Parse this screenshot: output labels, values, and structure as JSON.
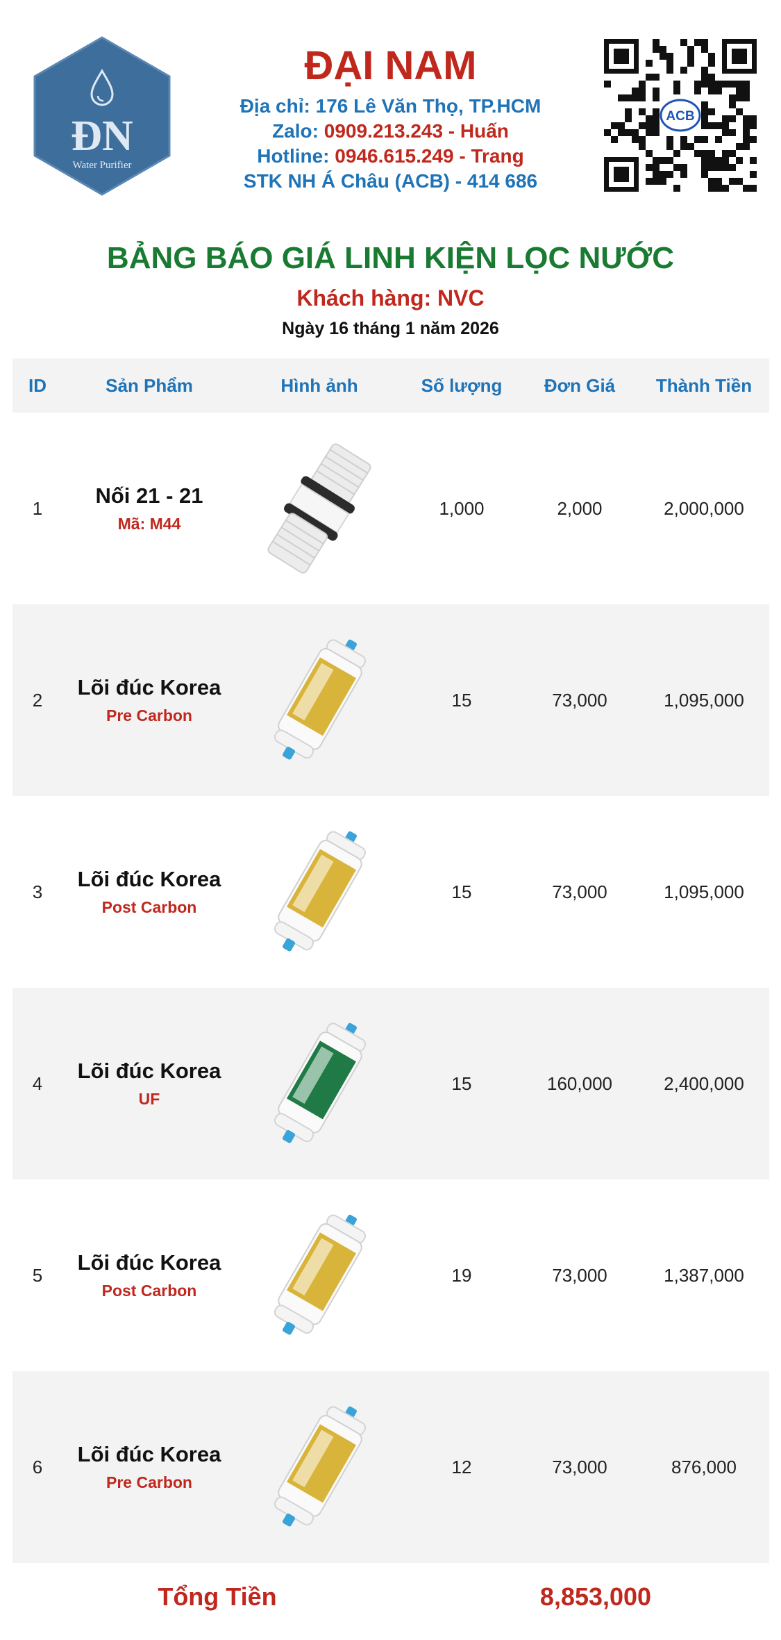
{
  "company": {
    "logo_text": "ĐN",
    "logo_sub": "Water Purifier",
    "name": "ĐẠI NAM",
    "address_label": "Địa chỉ:",
    "address_value": "176 Lê Văn Thọ, TP.HCM",
    "zalo_label": "Zalo:",
    "zalo_value": "0909.213.243 - Huấn",
    "hotline_label": "Hotline:",
    "hotline_value": "0946.615.249 - Trang",
    "bank": "STK NH Á Châu (ACB) - 414 686",
    "qr_badge": "ACB"
  },
  "document": {
    "title": "BẢNG BÁO GIÁ LINH KIỆN LỌC NƯỚC",
    "customer": "Khách hàng: NVC",
    "date": "Ngày 16 tháng 1 năm 2026"
  },
  "table": {
    "headers": {
      "id": "ID",
      "product": "Sản Phẩm",
      "image": "Hình ảnh",
      "quantity": "Số lượng",
      "unit_price": "Đơn Giá",
      "total": "Thành Tiền"
    },
    "rows": [
      {
        "id": "1",
        "name": "Nối 21 - 21",
        "code": "Mã: M44",
        "image": "connector-fitting",
        "quantity": "1,000",
        "unit_price": "2,000",
        "total": "2,000,000"
      },
      {
        "id": "2",
        "name": "Lõi đúc Korea",
        "code": "Pre Carbon",
        "image": "pre-carbon-filter",
        "label_color": "#d9b43a",
        "quantity": "15",
        "unit_price": "73,000",
        "total": "1,095,000"
      },
      {
        "id": "3",
        "name": "Lõi đúc Korea",
        "code": "Post Carbon",
        "image": "post-carbon-filter",
        "label_color": "#d9b43a",
        "quantity": "15",
        "unit_price": "73,000",
        "total": "1,095,000"
      },
      {
        "id": "4",
        "name": "Lõi đúc Korea",
        "code": "UF",
        "image": "uf-filter",
        "label_color": "#1f7a45",
        "quantity": "15",
        "unit_price": "160,000",
        "total": "2,400,000"
      },
      {
        "id": "5",
        "name": "Lõi đúc Korea",
        "code": "Post Carbon",
        "image": "post-carbon-filter",
        "label_color": "#d9b43a",
        "quantity": "19",
        "unit_price": "73,000",
        "total": "1,387,000"
      },
      {
        "id": "6",
        "name": "Lõi đúc Korea",
        "code": "Pre Carbon",
        "image": "pre-carbon-filter",
        "label_color": "#d9b43a",
        "quantity": "12",
        "unit_price": "73,000",
        "total": "876,000"
      }
    ]
  },
  "summary": {
    "total_label": "Tổng Tiền",
    "total_value": "8,853,000"
  },
  "colors": {
    "brand_red": "#c0281e",
    "brand_blue": "#1f73b7",
    "title_green": "#197a31",
    "logo_blue": "#3d6e9c"
  }
}
